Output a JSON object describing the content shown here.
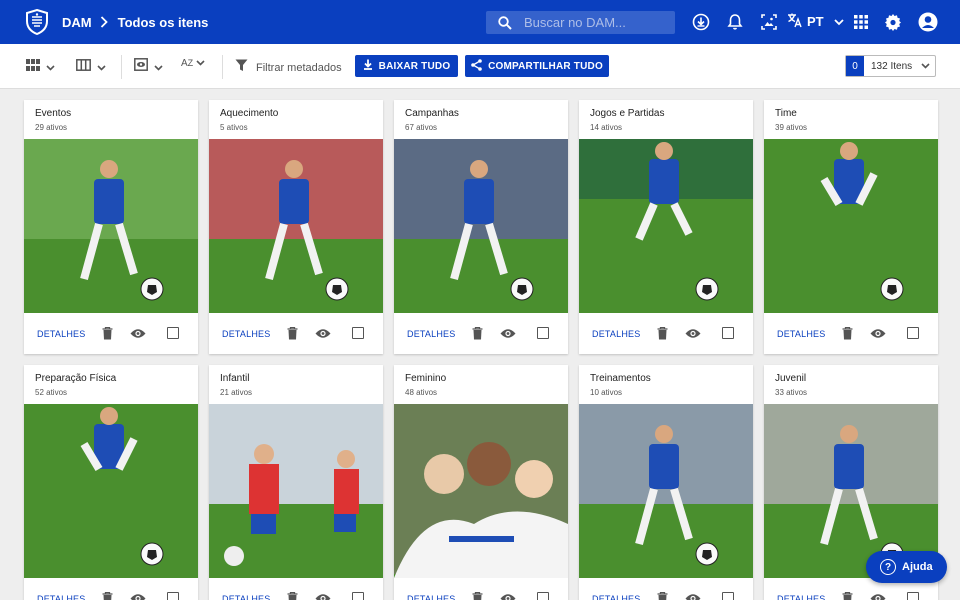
{
  "header": {
    "logo_icon": "shield-crest-icon",
    "breadcrumb": [
      "DAM",
      "Todos os itens"
    ],
    "search_placeholder": "Buscar no DAM...",
    "language": "PT",
    "icons": [
      "download-circle-icon",
      "bell-icon",
      "image-select-icon",
      "translate-icon",
      "apps-grid-icon",
      "gear-icon",
      "account-icon"
    ]
  },
  "toolbar": {
    "filter_label": "Filtrar metadados",
    "download_all": "BAIXAR TUDO",
    "share_all": "COMPARTILHAR TUDO",
    "selected_count": "0",
    "items_count": "132 Itens"
  },
  "cards": [
    {
      "title": "Eventos",
      "subtitle": "29 ativos",
      "scene": "player-leg-ball-park"
    },
    {
      "title": "Aquecimento",
      "subtitle": "5 ativos",
      "scene": "player-kicking-stadium"
    },
    {
      "title": "Campanhas",
      "subtitle": "67 ativos",
      "scene": "two-players-stadium-lights"
    },
    {
      "title": "Jogos e Partidas",
      "subtitle": "14 ativos",
      "scene": "legs-ball-grass"
    },
    {
      "title": "Time",
      "subtitle": "39 ativos",
      "scene": "overhead-player-ball"
    },
    {
      "title": "Preparação Física",
      "subtitle": "52 ativos",
      "scene": "agility-drill"
    },
    {
      "title": "Infantil",
      "subtitle": "21 ativos",
      "scene": "kids-playing"
    },
    {
      "title": "Feminino",
      "subtitle": "48 ativos",
      "scene": "women-team-hug"
    },
    {
      "title": "Treinamentos",
      "subtitle": "10 ativos",
      "scene": "player-dribbling-stadium"
    },
    {
      "title": "Juvenil",
      "subtitle": "33 ativos",
      "scene": "youth-player-back"
    }
  ],
  "card_actions": {
    "details": "DETALHES",
    "icons": [
      "trash-icon",
      "eye-icon",
      "checkbox-icon"
    ]
  },
  "help": {
    "label": "Ajuda",
    "symbol": "?"
  },
  "colors": {
    "primary": "#0a3fbf",
    "background": "#eeeeee",
    "grass": "#3f8a2c"
  }
}
